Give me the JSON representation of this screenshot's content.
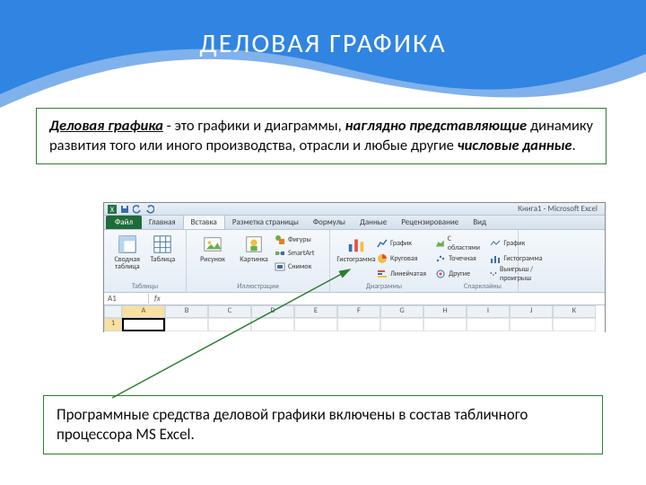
{
  "slide": {
    "title": "ДЕЛОВАЯ ГРАФИКА"
  },
  "definition": {
    "term": "Деловая графика",
    "mid1": " - это графики и диаграммы, ",
    "em1": "наглядно представляющие",
    "mid2": " динамику развития того или иного производства, отрасли и любые другие ",
    "em2": "числовые данные",
    "end": "."
  },
  "excel": {
    "window_title": "Книга1 - Microsoft Excel",
    "tabs": {
      "file": "Файл",
      "home": "Главная",
      "insert": "Вставка",
      "page": "Разметка страницы",
      "formulas": "Формулы",
      "data": "Данные",
      "review": "Рецензирование",
      "view": "Вид"
    },
    "groups": {
      "tables": "Таблицы",
      "illustrations": "Иллюстрации",
      "charts": "Диаграммы",
      "sparklines": "Спарклайны"
    },
    "buttons": {
      "pivot": "Сводная таблица",
      "table": "Таблица",
      "picture": "Рисунок",
      "clipart": "Картинка",
      "shapes": "Фигуры",
      "smartart": "SmartArt",
      "screenshot": "Снимок",
      "column_chart": "Гистограмма",
      "line_chart": "График",
      "pie_chart": "Круговая",
      "bar_chart": "Линейчатая",
      "area_chart": "С областями",
      "scatter_chart": "Точечная",
      "other_chart": "Другие",
      "spark_line": "График",
      "spark_col": "Гистограмма",
      "spark_winloss": "Выигрыш / проигрыш"
    },
    "namebox": "A1",
    "fx": "fx",
    "columns": [
      "A",
      "B",
      "C",
      "D",
      "E",
      "F",
      "G",
      "H",
      "I",
      "J",
      "K"
    ],
    "row1": "1"
  },
  "note": {
    "text": "Программные средства деловой графики включены в состав табличного процессора MS Excel."
  }
}
